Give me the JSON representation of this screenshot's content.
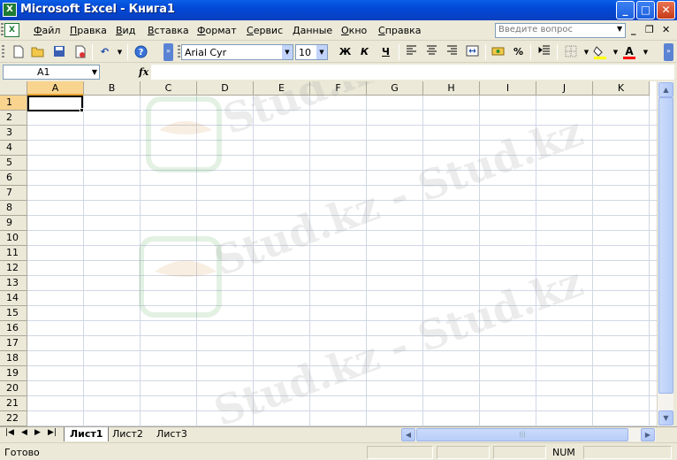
{
  "window": {
    "title": "Microsoft Excel - Книга1",
    "app_icon": "excel-icon",
    "controls": [
      "minimize",
      "maximize",
      "close"
    ]
  },
  "menubar": {
    "items": [
      "Файл",
      "Правка",
      "Вид",
      "Вставка",
      "Формат",
      "Сервис",
      "Данные",
      "Окно",
      "Справка"
    ],
    "help_box_placeholder": "Введите вопрос"
  },
  "toolbar": {
    "font": "Arial Cyr",
    "font_size": "10",
    "bold": "Ж",
    "italic": "К",
    "underline": "Ч",
    "percent": "%",
    "font_color": "#FF0000",
    "fill_color": "#FFFF00"
  },
  "formula_bar": {
    "name_box": "A1",
    "fx": "fx",
    "value": ""
  },
  "grid": {
    "columns": [
      "A",
      "B",
      "C",
      "D",
      "E",
      "F",
      "G",
      "H",
      "I",
      "J",
      "K"
    ],
    "rows": [
      "1",
      "2",
      "3",
      "4",
      "5",
      "6",
      "7",
      "8",
      "9",
      "10",
      "11",
      "12",
      "13",
      "14",
      "15",
      "16",
      "17",
      "18",
      "19",
      "20",
      "21",
      "22"
    ],
    "active_cell": "A1"
  },
  "sheets": {
    "tabs": [
      "Лист1",
      "Лист2",
      "Лист3"
    ],
    "active": "Лист1"
  },
  "watermark": {
    "text": "Stud.kz - Stud.kz"
  },
  "statusbar": {
    "status": "Готово",
    "num": "NUM"
  }
}
